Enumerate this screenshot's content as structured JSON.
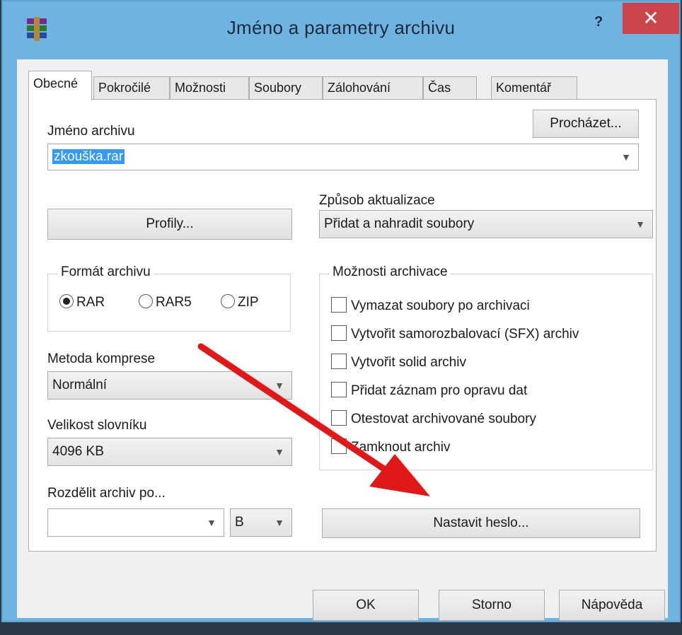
{
  "window": {
    "title": "Jméno a parametry archivu",
    "help_label": "?",
    "close_label": "✕"
  },
  "tabs": [
    {
      "label": "Obecné",
      "active": true
    },
    {
      "label": "Pokročilé"
    },
    {
      "label": "Možnosti"
    },
    {
      "label": "Soubory"
    },
    {
      "label": "Zálohování"
    },
    {
      "label": "Čas"
    },
    {
      "label": "Komentář"
    }
  ],
  "archive_name": {
    "label": "Jméno archivu",
    "browse_label": "Procházet...",
    "value": "zkouška.rar"
  },
  "profiles_label": "Profily...",
  "update_mode": {
    "label": "Způsob aktualizace",
    "value": "Přidat a nahradit soubory"
  },
  "format": {
    "title": "Formát archivu",
    "options": [
      {
        "label": "RAR",
        "selected": true
      },
      {
        "label": "RAR5",
        "selected": false
      },
      {
        "label": "ZIP",
        "selected": false
      }
    ]
  },
  "archive_options": {
    "title": "Možnosti archivace",
    "items": [
      {
        "label": "Vymazat soubory po archivaci",
        "checked": false
      },
      {
        "label": "Vytvořit samorozbalovací (SFX) archiv",
        "checked": false
      },
      {
        "label": "Vytvořit solid archiv",
        "checked": false
      },
      {
        "label": "Přidat záznam pro opravu dat",
        "checked": false
      },
      {
        "label": "Otestovat archivované soubory",
        "checked": false
      },
      {
        "label": "Zamknout archiv",
        "checked": false
      }
    ]
  },
  "compression": {
    "label": "Metoda komprese",
    "value": "Normální"
  },
  "dictionary": {
    "label": "Velikost slovníku",
    "value": "4096 KB"
  },
  "split": {
    "label": "Rozdělit archiv po...",
    "value": "",
    "unit": "B"
  },
  "set_password_label": "Nastavit heslo...",
  "footer": {
    "ok_label": "OK",
    "cancel_label": "Storno",
    "help_label": "Nápověda"
  },
  "colors": {
    "titlebar": "#6fb3e3",
    "close_button": "#c9474a",
    "annotation_arrow": "#e01818",
    "selection": "#3399ff"
  }
}
